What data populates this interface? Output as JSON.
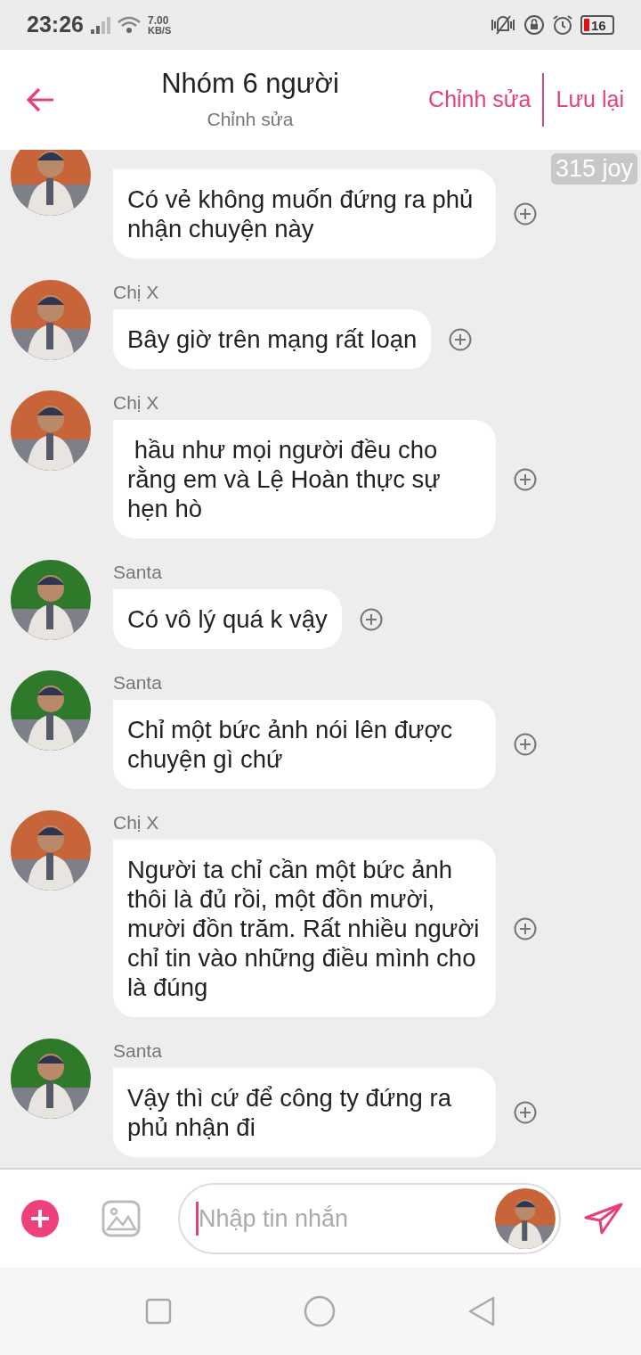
{
  "status_bar": {
    "time": "23:26",
    "speed_value": "7.00",
    "speed_unit": "KB/S",
    "battery": "16"
  },
  "header": {
    "title": "Nhóm 6 người",
    "subtitle": "Chỉnh sửa",
    "actions": [
      "Chỉnh sửa",
      "Lưu lại"
    ]
  },
  "badge": "315 joy",
  "messages": [
    {
      "text": "Có vẻ không muốn đứng ra phủ nhận chuyện này",
      "color": "#c8643a"
    },
    {
      "sender": "Chị X",
      "text": "Bây giờ trên mạng rất loạn",
      "color": "#c8643a"
    },
    {
      "sender": "Chị X",
      "text": " hầu như mọi người đều cho rằng em và Lệ Hoàn thực sự hẹn hò",
      "color": "#c8643a"
    },
    {
      "sender": "Santa",
      "text": "Có vô lý quá k vậy",
      "color": "#2f7a2a"
    },
    {
      "sender": "Santa",
      "text": "Chỉ một bức ảnh nói lên được chuyện gì chứ",
      "color": "#2f7a2a"
    },
    {
      "sender": "Chị X",
      "text": "Người ta chỉ cần một bức ảnh thôi là đủ rồi, một đồn mười, mười đồn trăm. Rất nhiều người chỉ tin vào những điều mình cho là đúng",
      "color": "#c8643a"
    },
    {
      "sender": "Santa",
      "text": "Vậy thì cứ để công ty đứng ra phủ nhận đi",
      "color": "#2f7a2a"
    }
  ],
  "composer": {
    "placeholder": "Nhập tin nhắn"
  }
}
